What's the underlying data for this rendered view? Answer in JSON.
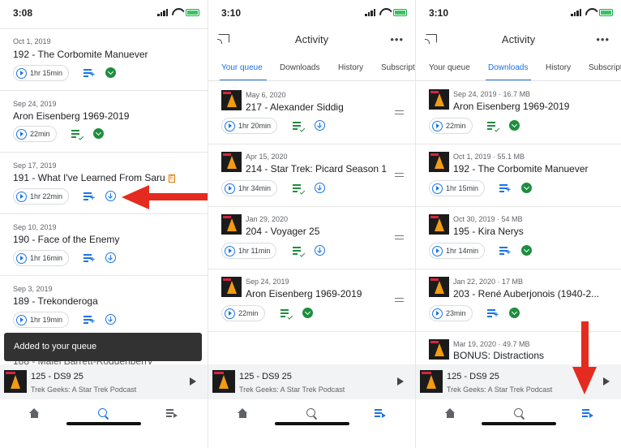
{
  "panel1": {
    "time": "3:08",
    "episodes": [
      {
        "date": "Oct 1, 2019",
        "title": "192 - The Corbomite Manuever",
        "duration": "1hr 15min",
        "queue": "add",
        "download": "done"
      },
      {
        "date": "Sep 24, 2019",
        "title": "Aron Eisenberg 1969-2019",
        "duration": "22min",
        "queue": "queued",
        "download": "done"
      },
      {
        "date": "Sep 17, 2019",
        "title": "191 - What I've Learned From Saru",
        "explicit": "E",
        "duration": "1hr 22min",
        "queue": "add",
        "download": "open"
      },
      {
        "date": "Sep 10, 2019",
        "title": "190 - Face of the Enemy",
        "duration": "1hr 16min",
        "queue": "add",
        "download": "open"
      },
      {
        "date": "Sep 3, 2019",
        "title": "189 - Trekonderoga",
        "duration": "1hr 19min",
        "queue": "add",
        "download": "open"
      }
    ],
    "partial_title": "188 - Majel Barrett-Roddenberry",
    "toast": "Added to your queue"
  },
  "panel2": {
    "time": "3:10",
    "title": "Activity",
    "tabs": [
      "Your queue",
      "Downloads",
      "History",
      "Subscripti"
    ],
    "active_tab": 0,
    "episodes": [
      {
        "date": "May 6, 2020",
        "title": "217 - Alexander Siddig",
        "duration": "1hr 20min",
        "queue": "queued",
        "download": "open"
      },
      {
        "date": "Apr 15, 2020",
        "title": "214 - Star Trek: Picard Season 1",
        "duration": "1hr 34min",
        "queue": "queued",
        "download": "open"
      },
      {
        "date": "Jan 29, 2020",
        "title": "204 - Voyager 25",
        "duration": "1hr 11min",
        "queue": "queued",
        "download": "open"
      },
      {
        "date": "Sep 24, 2019",
        "title": "Aron Eisenberg 1969-2019",
        "duration": "22min",
        "queue": "queued",
        "download": "done"
      }
    ]
  },
  "panel3": {
    "time": "3:10",
    "title": "Activity",
    "tabs": [
      "Your queue",
      "Downloads",
      "History",
      "Subscripti"
    ],
    "active_tab": 1,
    "episodes": [
      {
        "date": "Sep 24, 2019 · 16.7 MB",
        "title": "Aron Eisenberg 1969-2019",
        "duration": "22min",
        "queue": "queued",
        "download": "done"
      },
      {
        "date": "Oct 1, 2019 · 55.1 MB",
        "title": "192 - The Corbomite Manuever",
        "duration": "1hr 15min",
        "queue": "add",
        "download": "done"
      },
      {
        "date": "Oct 30, 2019 · 54 MB",
        "title": "195 - Kira Nerys",
        "duration": "1hr 14min",
        "queue": "add",
        "download": "done"
      },
      {
        "date": "Jan 22, 2020 · 17 MB",
        "title": "203 - René Auberjonois (1940-2...",
        "duration": "23min",
        "queue": "add",
        "download": "done"
      },
      {
        "date": "Mar 19, 2020 · 49.7 MB",
        "title": "BONUS: Distractions",
        "duration": "",
        "queue": "",
        "download": ""
      }
    ]
  },
  "miniplayer": {
    "title": "125 - DS9 25",
    "subtitle": "Trek Geeks: A Star Trek Podcast"
  },
  "colors": {
    "accent": "#1a73e8",
    "done": "#1e8e3e",
    "annotation": "#e52b1f"
  }
}
